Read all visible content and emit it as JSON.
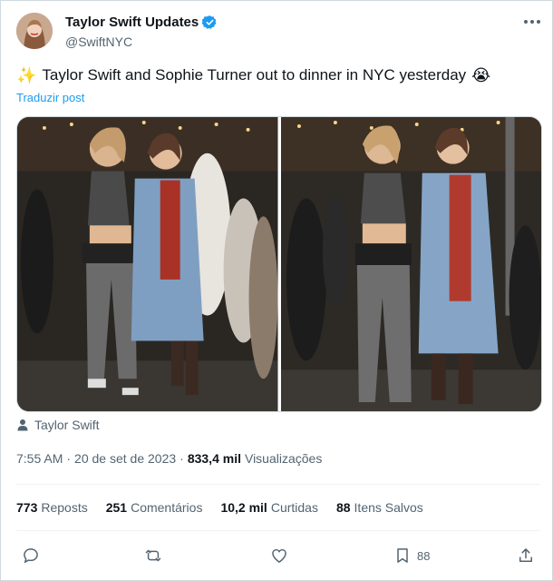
{
  "author": {
    "display_name": "Taylor Swift Updates",
    "handle": "@SwiftNYC",
    "verified_color": "#1d9bf0"
  },
  "post": {
    "sparkle_emoji": "✨",
    "text": "Taylor Swift and Sophie Turner out to dinner in NYC yesterday",
    "crying_emoji": "😭",
    "translate_label": "Traduzir post"
  },
  "tagged_person": "Taylor Swift",
  "meta": {
    "time": "7:55 AM",
    "separator": "·",
    "date": "20 de set de 2023",
    "views_count": "833,4 mil",
    "views_label": "Visualizações"
  },
  "stats": {
    "reposts": {
      "count": "773",
      "label": "Reposts"
    },
    "comments": {
      "count": "251",
      "label": "Comentários"
    },
    "likes": {
      "count": "10,2 mil",
      "label": "Curtidas"
    },
    "saves": {
      "count": "88",
      "label": "Itens Salvos"
    }
  },
  "actions": {
    "reply_icon": "reply-icon",
    "repost_icon": "repost-icon",
    "like_icon": "heart-icon",
    "bookmark_icon": "bookmark-icon",
    "bookmark_count": "88",
    "share_icon": "share-icon"
  }
}
